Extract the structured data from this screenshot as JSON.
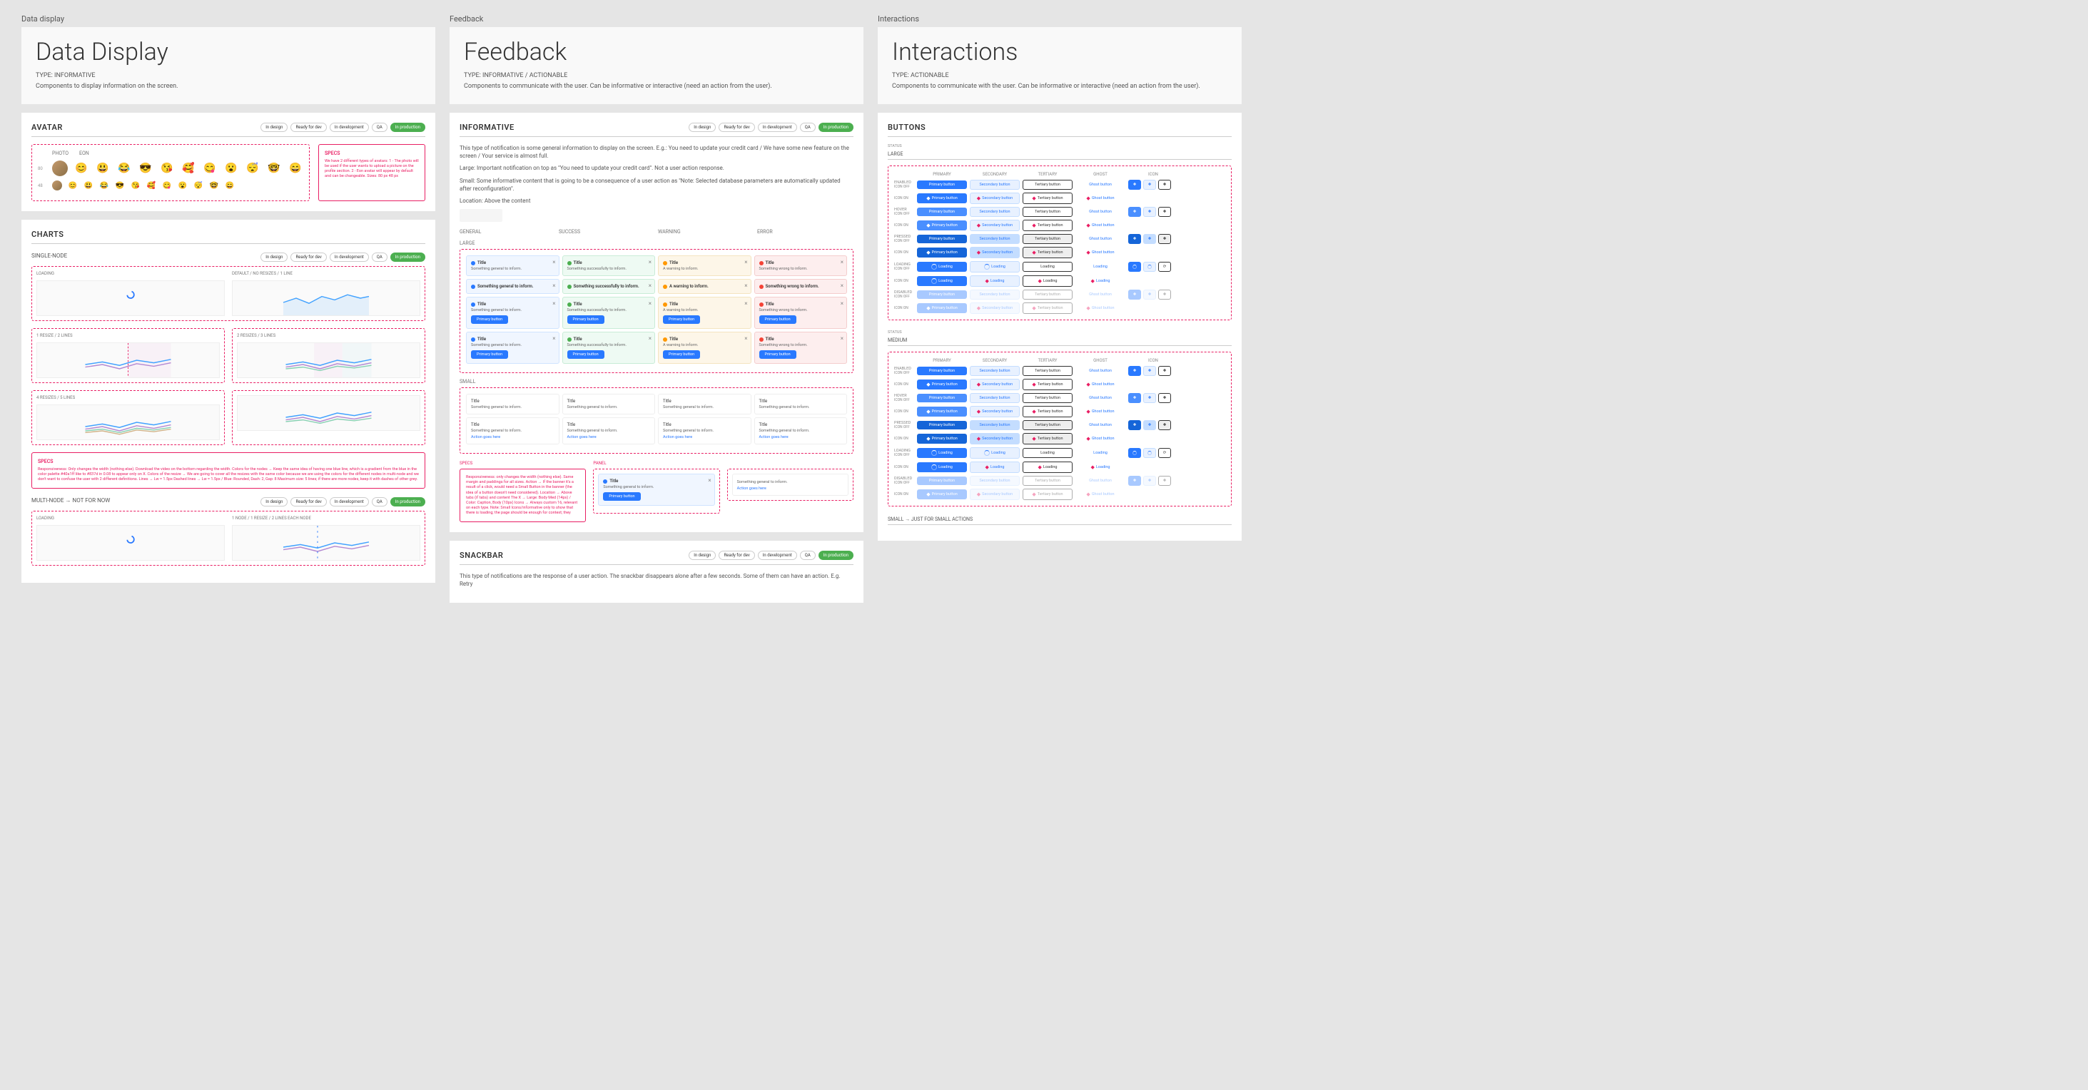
{
  "sections": {
    "data_display": {
      "label": "Data display",
      "title": "Data Display",
      "type": "TYPE: INFORMATIVE",
      "description": "Components to display information on the screen."
    },
    "feedback": {
      "label": "Feedback",
      "title": "Feedback",
      "type": "TYPE: INFORMATIVE / ACTIONABLE",
      "description": "Components to communicate with the user. Can be informative or interactive (need an action from the user)."
    },
    "interactions": {
      "label": "Interactions",
      "title": "Interactions",
      "type": "TYPE: ACTIONABLE",
      "description": "Components to communicate with the user. Can be informative or interactive (need an action from the user)."
    }
  },
  "status_pills": {
    "in_design": "In design",
    "ready_for_dev": "Ready for dev",
    "in_development": "In development",
    "qa": "QA",
    "in_production": "In production"
  },
  "avatar": {
    "title": "AVATAR",
    "cols": {
      "size": "",
      "photo": "PHOTO",
      "eon": "EON"
    },
    "rows": [
      "80",
      "48"
    ],
    "emojis": [
      "😊",
      "😃",
      "😂",
      "😎",
      "😘",
      "🥰",
      "😋",
      "😮",
      "😴",
      "🤓",
      "😄"
    ],
    "specs_title": "SPECS",
    "specs_text": "We have 2 different types of avatars:\n1 - The photo will be used if the user wants to upload a picture on the profile section.\n2 - Eon avatar will appear by default and can be changeable.\nSizes:\n80 px\n48 px"
  },
  "charts": {
    "title": "CHARTS",
    "single_node": "SINGLE-NODE",
    "multi_node": "MULTI-NODE → NOT FOR NOW",
    "loading": "LOADING",
    "default": "DEFAULT / NO RESIZES / 1 LINE",
    "resize1": "1 RESIZE / 2 LINES",
    "resize2": "2 RESIZES / 3 LINES",
    "resize4": "4 RESIZES / 5 LINES",
    "multi_right": "1 NODE / 1 RESIZE / 2 LINES EACH NODE",
    "specs_title": "SPECS",
    "specs_text": "Responsiveness: Only changes the width (nothing else). Download the video on the bottom regarding the width.\nColors for the nodes → Keep the same idea of having one blue line, which is a gradient from the blue in the color palette #40a1ff like to #837d in 0.08 to appear only on X.\nColors of the resize → We are going to cover all the resizes with the same color because we are using the colors for the different nodes in multi-node and we don't want to confuse the user with 2 different definitions.\nLines → Lw = 1.5px\nDashed lines → Lw = 1.5px / Blue: Rounded, Dash: 2, Gap: 8\nMaximum size: 5 lines; if there are more nodes, keep it with dashes of other grey."
  },
  "informative": {
    "title": "INFORMATIVE",
    "desc1": "This type of notification is some general information to display on the screen. E.g.: You need to update your credit card / We have some new feature on the screen / Your service is almost full.",
    "desc2": "Large: Important notification on top as \"You need to update your credit card\". Not a user action response.",
    "desc3": "Small: Some informative content that is going to be a consequence of a user action as \"Note: Selected database parameters are automatically updated after reconfiguration\".",
    "desc4": "Location: Above the content",
    "headers": {
      "general": "GENERAL",
      "success": "SUCCESS",
      "warning": "WARNING",
      "error": "ERROR"
    },
    "large_label": "LARGE",
    "small_label": "SMALL",
    "cell_title": "Title",
    "cell_general": "Something general to inform.",
    "cell_success": "Something successfully to inform.",
    "cell_warning": "A warning to inform.",
    "cell_error": "Something wrong to inform.",
    "primary_btn": "Primary button",
    "action_link": "Action goes here",
    "specs_title": "SPECS",
    "specs_text": "Responsiveness: only changes the width (nothing else). Same margin and paddings for all sizes.\nAction → If the banner it's a result of a click, would need a Small Button in the banner (the idea of a button doesn't need considered).\nLocation → Above tabs (if tabs) and content\nThe X → Large: Body Med (14px) / Color: Caption, Body (10px)\nIcons → Always custom 16, relevant on each type.\nNote: Small Icons/informative only to show that there is loading; the page should be enough for context; they",
    "panel_label": "PANEL",
    "small_panel_title": "Title",
    "small_panel_general_text": "Something general to inform.",
    "small_panel_action": "Action goes here"
  },
  "snackbar": {
    "title": "SNACKBAR",
    "desc": "This type of notifications are the response of a user action. The snackbar disappears alone after a few seconds. Some of them can have an action. E.g. Retry"
  },
  "buttons": {
    "title": "BUTTONS",
    "size_large": "LARGE",
    "size_medium": "MEDIUM",
    "size_small": "SMALL → JUST FOR SMALL ACTIONS",
    "cols": {
      "status": "STATUS",
      "primary": "PRIMARY",
      "secondary": "SECONDARY",
      "tertiary": "TERTIARY",
      "ghost": "GHOST",
      "icon": "ICON"
    },
    "states": {
      "enabled": "ENABLED",
      "icon_off": "Icon off",
      "icon_on": "Icon on",
      "hover": "HOVER",
      "pressed": "PRESSED",
      "loading": "LOADING",
      "disabled": "DISABLED"
    },
    "labels": {
      "primary": "Primary button",
      "secondary": "Secondary button",
      "tertiary": "Tertiary button",
      "ghost": "Ghost button",
      "loading": "Loading"
    }
  }
}
